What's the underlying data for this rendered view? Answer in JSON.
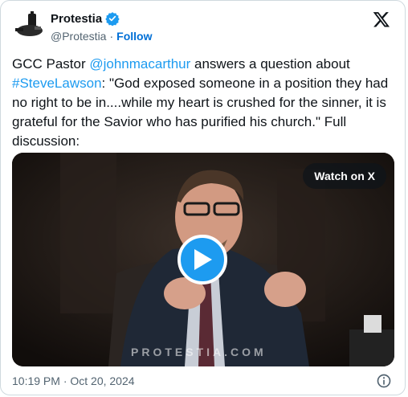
{
  "author": {
    "name": "Protestia",
    "handle": "@Protestia",
    "separator": "·",
    "follow_label": "Follow"
  },
  "tweet": {
    "t1": "GCC Pastor ",
    "mention": "@johnmacarthur",
    "t2": "  answers a question about ",
    "hashtag": "#SteveLawson",
    "t3": ": \"God exposed someone in a position they had no right to be in....while my heart is crushed for the sinner, it is grateful for the Savior who has purified his church.\" Full discussion:"
  },
  "media": {
    "watch_label": "Watch on X",
    "watermark": "PROTESTIA.COM"
  },
  "footer": {
    "timestamp": "10:19 PM · Oct 20, 2024"
  },
  "colors": {
    "accent": "#1d9bf0",
    "follow": "#006fd6",
    "text": "#0f1419",
    "muted": "#536471"
  },
  "icons": [
    "protestia-logo-icon",
    "verified-badge-icon",
    "x-logo-icon",
    "play-icon",
    "info-icon"
  ]
}
